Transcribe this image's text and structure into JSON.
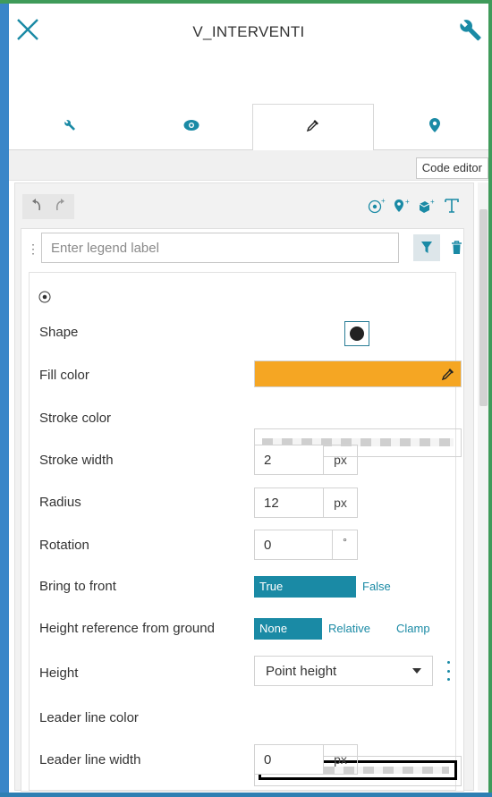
{
  "window": {
    "title": "V_INTERVENTI"
  },
  "tabs": [
    {
      "icon": "wrench-icon",
      "active": false
    },
    {
      "icon": "eye-icon",
      "active": false
    },
    {
      "icon": "eyedropper-icon",
      "active": true
    },
    {
      "icon": "map-pin-icon",
      "active": false
    }
  ],
  "code_editor_label": "Code editor",
  "toolbar": {
    "left_icons": [
      "undo-icon",
      "redo-icon"
    ],
    "right_icons": [
      "add-point-icon",
      "add-marker-icon",
      "add-model-icon",
      "add-text-icon"
    ]
  },
  "legend": {
    "placeholder": "Enter legend label"
  },
  "properties": {
    "shape_label": "Shape",
    "fill_color_label": "Fill color",
    "fill_color": "#f5a623",
    "stroke_color_label": "Stroke color",
    "stroke_width_label": "Stroke width",
    "stroke_width_value": "2",
    "stroke_width_unit": "px",
    "radius_label": "Radius",
    "radius_value": "12",
    "radius_unit": "px",
    "rotation_label": "Rotation",
    "rotation_value": "0",
    "rotation_unit": "°",
    "bring_to_front_label": "Bring to front",
    "bring_to_front_true": "True",
    "bring_to_front_false": "False",
    "height_ref_label": "Height reference from ground",
    "height_ref_none": "None",
    "height_ref_relative": "Relative",
    "height_ref_clamp": "Clamp",
    "height_label": "Height",
    "height_value": "Point height",
    "leader_line_color_label": "Leader line color",
    "leader_line_width_label": "Leader line width",
    "leader_line_width_value": "0",
    "leader_line_width_unit": "px"
  },
  "colors": {
    "accent": "#1a8aa5",
    "fill": "#f5a623"
  }
}
